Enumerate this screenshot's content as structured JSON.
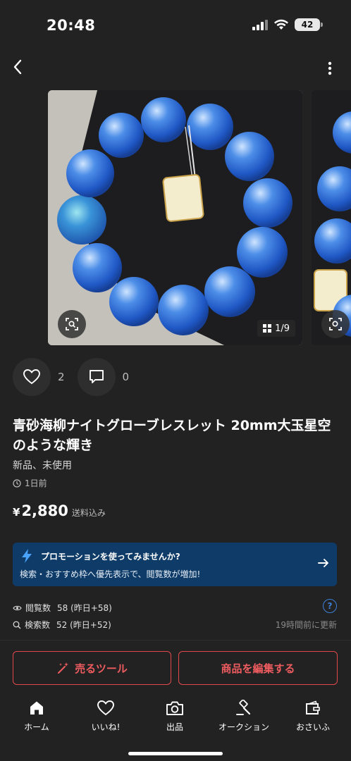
{
  "status_bar": {
    "time": "20:48",
    "battery": "42"
  },
  "gallery": {
    "counter": "1/9"
  },
  "reactions": {
    "likes": "2",
    "comments": "0"
  },
  "item": {
    "title": "青砂海柳ナイトグローブレスレット 20mm大玉星空のような輝き",
    "condition": "新品、未使用",
    "posted": "1日前",
    "currency": "¥",
    "price": "2,880",
    "shipping": "送料込み"
  },
  "promo": {
    "title": "プロモーションを使ってみませんか?",
    "description": "検索・おすすめ枠へ優先表示で、閲覧数が増加!"
  },
  "stats": {
    "views_label": "閲覧数",
    "views_value": "58 (昨日+58)",
    "search_label": "検索数",
    "search_value": "52 (昨日+52)",
    "updated": "19時間前に更新"
  },
  "buttons": {
    "sell_tool": "売るツール",
    "edit_item": "商品を編集する"
  },
  "tabs": [
    {
      "label": "ホーム",
      "icon": "home-icon"
    },
    {
      "label": "いいね!",
      "icon": "heart-icon"
    },
    {
      "label": "出品",
      "icon": "camera-icon"
    },
    {
      "label": "オークション",
      "icon": "gavel-icon"
    },
    {
      "label": "おさいふ",
      "icon": "wallet-icon"
    }
  ],
  "colors": {
    "background": "#222222",
    "accent": "#e0484e",
    "promo": "#0e3b67",
    "help": "#3d7fd6"
  }
}
